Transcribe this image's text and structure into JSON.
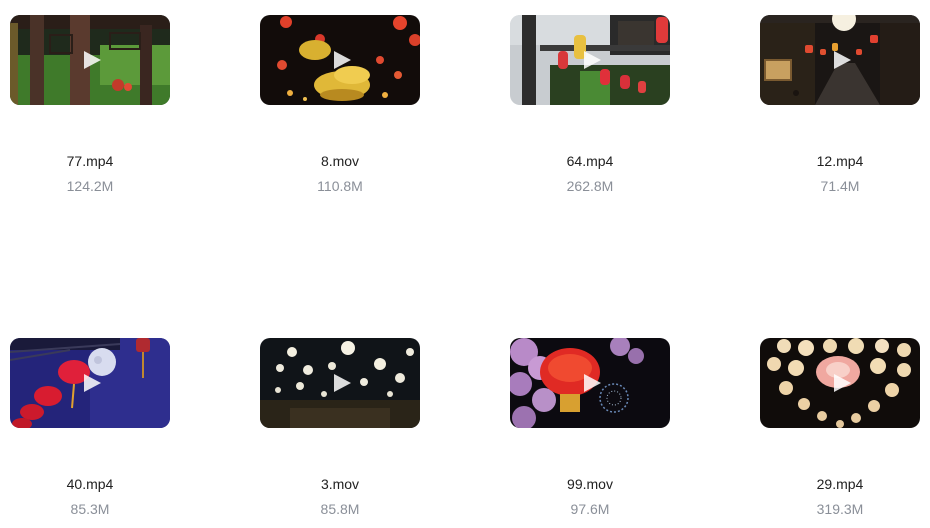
{
  "videos": [
    {
      "name": "77.mp4",
      "size": "124.2M",
      "scene": "pavilion"
    },
    {
      "name": "8.mov",
      "size": "110.8M",
      "scene": "ingot-lanterns"
    },
    {
      "name": "64.mp4",
      "size": "262.8M",
      "scene": "eaves-lanterns"
    },
    {
      "name": "12.mp4",
      "size": "71.4M",
      "scene": "night-street"
    },
    {
      "name": "40.mp4",
      "size": "85.3M",
      "scene": "moon-lanterns"
    },
    {
      "name": "3.mov",
      "size": "85.8M",
      "scene": "white-lanterns"
    },
    {
      "name": "99.mov",
      "size": "97.6M",
      "scene": "blossom-lantern"
    },
    {
      "name": "29.mp4",
      "size": "319.3M",
      "scene": "heart-lanterns"
    }
  ],
  "icons": {
    "play": "play-icon"
  }
}
